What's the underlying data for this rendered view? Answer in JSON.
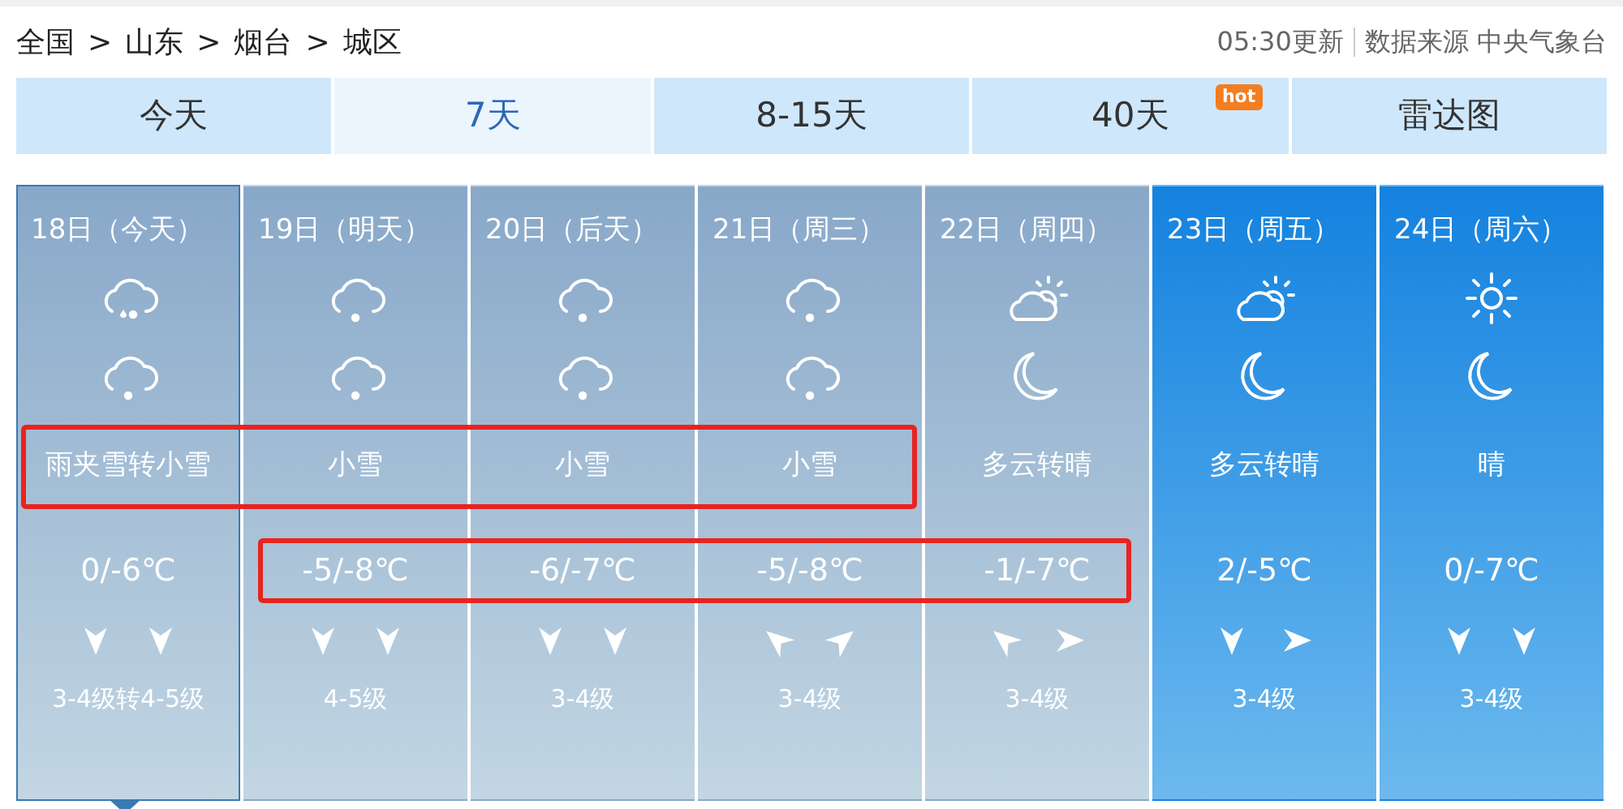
{
  "breadcrumb": [
    "全国",
    "山东",
    "烟台",
    "城区"
  ],
  "breadcrumb_separator": ">",
  "update_time": "05:30更新",
  "source": "数据来源 中央气象台",
  "tabs": [
    {
      "label": "今天",
      "selected": false
    },
    {
      "label": "7天",
      "selected": true
    },
    {
      "label": "8-15天",
      "selected": false
    },
    {
      "label": "40天",
      "selected": false,
      "badge": "hot"
    },
    {
      "label": "雷达图",
      "selected": false
    }
  ],
  "days": [
    {
      "date": "18日（今天）",
      "selected": true,
      "highlighted": false,
      "icons": [
        {
          "kind": "sleet"
        },
        {
          "kind": "snow"
        }
      ],
      "weather": "雨夹雪转小雪",
      "weather_marked": true,
      "temp": "0/-6℃",
      "temp_marked": false,
      "wind": [
        {
          "kind": "down"
        },
        {
          "kind": "down"
        }
      ],
      "wind_level": "3-4级转4-5级"
    },
    {
      "date": "19日（明天）",
      "selected": false,
      "highlighted": false,
      "icons": [
        {
          "kind": "snow"
        },
        {
          "kind": "snow"
        }
      ],
      "weather": "小雪",
      "weather_marked": true,
      "temp": "-5/-8℃",
      "temp_marked": true,
      "wind": [
        {
          "kind": "down"
        },
        {
          "kind": "down"
        }
      ],
      "wind_level": "4-5级"
    },
    {
      "date": "20日（后天）",
      "selected": false,
      "highlighted": false,
      "icons": [
        {
          "kind": "snow"
        },
        {
          "kind": "snow"
        }
      ],
      "weather": "小雪",
      "weather_marked": true,
      "temp": "-6/-7℃",
      "temp_marked": true,
      "wind": [
        {
          "kind": "down"
        },
        {
          "kind": "down"
        }
      ],
      "wind_level": "3-4级"
    },
    {
      "date": "21日（周三）",
      "selected": false,
      "highlighted": false,
      "icons": [
        {
          "kind": "snow"
        },
        {
          "kind": "snow"
        }
      ],
      "weather": "小雪",
      "weather_marked": true,
      "temp": "-5/-8℃",
      "temp_marked": true,
      "wind": [
        {
          "kind": "upleft"
        },
        {
          "kind": "upright"
        }
      ],
      "wind_level": "3-4级"
    },
    {
      "date": "22日（周四）",
      "selected": false,
      "highlighted": false,
      "icons": [
        {
          "kind": "partlycloudy"
        },
        {
          "kind": "moon"
        }
      ],
      "weather": "多云转晴",
      "weather_marked": false,
      "temp": "-1/-7℃",
      "temp_marked": true,
      "wind": [
        {
          "kind": "upleft"
        },
        {
          "kind": "right"
        }
      ],
      "wind_level": "3-4级"
    },
    {
      "date": "23日（周五）",
      "selected": false,
      "highlighted": true,
      "icons": [
        {
          "kind": "partlycloudy"
        },
        {
          "kind": "moon"
        }
      ],
      "weather": "多云转晴",
      "weather_marked": false,
      "temp": "2/-5℃",
      "temp_marked": false,
      "wind": [
        {
          "kind": "down"
        },
        {
          "kind": "right"
        }
      ],
      "wind_level": "3-4级"
    },
    {
      "date": "24日（周六）",
      "selected": false,
      "highlighted": true,
      "icons": [
        {
          "kind": "sunny"
        },
        {
          "kind": "moon"
        }
      ],
      "weather": "晴",
      "weather_marked": false,
      "temp": "0/-7℃",
      "temp_marked": false,
      "wind": [
        {
          "kind": "down"
        },
        {
          "kind": "down"
        }
      ],
      "wind_level": "3-4级"
    }
  ]
}
